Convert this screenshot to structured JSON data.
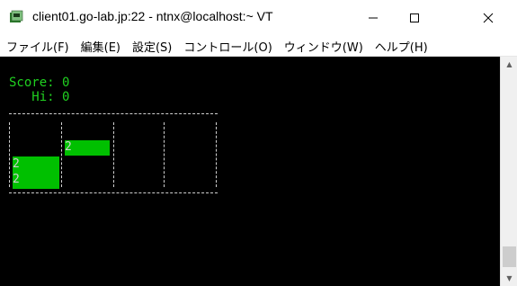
{
  "window": {
    "title": "client01.go-lab.jp:22 - ntnx@localhost:~ VT",
    "icon": "terminal-app-icon",
    "controls": [
      "minimize-icon",
      "maximize-icon",
      "close-icon"
    ]
  },
  "menu": {
    "items": [
      "ファイル(F)",
      "編集(E)",
      "設定(S)",
      "コントロール(O)",
      "ウィンドウ(W)",
      "ヘルプ(H)"
    ]
  },
  "terminal": {
    "score_line": "Score: 0",
    "hi_line": "   Hi: 0",
    "text_color": "#20d020",
    "tiles": [
      {
        "value": "2",
        "col": 2,
        "row": 1
      },
      {
        "value": "2",
        "col": 1,
        "row": 2
      },
      {
        "value": "2",
        "col": 1,
        "row": 3
      }
    ],
    "tile_color": "#00c000"
  },
  "scrollbar": {
    "up_arrow": "▲",
    "down_arrow": "▼"
  }
}
